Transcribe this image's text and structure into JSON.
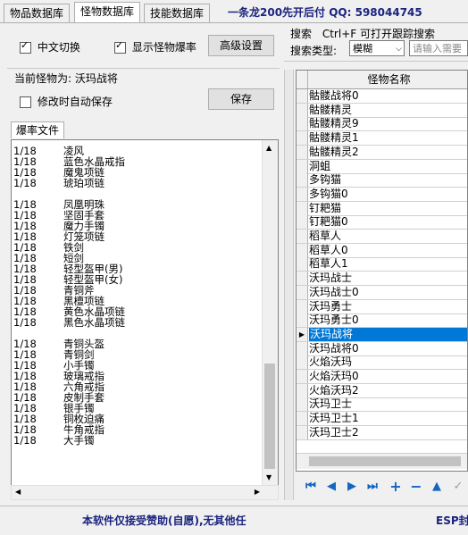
{
  "tabs": [
    "物品数据库",
    "怪物数据库",
    "技能数据库"
  ],
  "promo_text": "一条龙200先开后付 QQ: 598044745",
  "toolbar": {
    "chinese_switch": "中文切换",
    "show_drops": "显示怪物爆率",
    "advanced_settings": "高级设置",
    "search_label": "搜索",
    "search_hint": "Ctrl+F 可打开跟踪搜索",
    "search_type_label": "搜索类型:",
    "search_type_value": "模糊",
    "search_placeholder": "请输入需要"
  },
  "current_monster": {
    "label": "当前怪物为: 沃玛战将",
    "auto_save": "修改时自动保存",
    "save_button": "保存"
  },
  "drop_file": {
    "title": "爆率文件",
    "lines": [
      [
        "1/18",
        "凌风"
      ],
      [
        "1/18",
        "蓝色水晶戒指"
      ],
      [
        "1/18",
        "魔鬼项链"
      ],
      [
        "1/18",
        "琥珀项链"
      ],
      [
        "",
        ""
      ],
      [
        "1/18",
        "凤凰明珠"
      ],
      [
        "1/18",
        "坚固手套"
      ],
      [
        "1/18",
        "魔力手镯"
      ],
      [
        "1/18",
        "灯笼项链"
      ],
      [
        "1/18",
        "铁剑"
      ],
      [
        "1/18",
        "短剑"
      ],
      [
        "1/18",
        "轻型盔甲(男)"
      ],
      [
        "1/18",
        "轻型盔甲(女)"
      ],
      [
        "1/18",
        "青铜斧"
      ],
      [
        "1/18",
        "黑檀项链"
      ],
      [
        "1/18",
        "黄色水晶项链"
      ],
      [
        "1/18",
        "黑色水晶项链"
      ],
      [
        "",
        ""
      ],
      [
        "1/18",
        "青铜头盔"
      ],
      [
        "1/18",
        "青铜剑"
      ],
      [
        "1/18",
        "小手镯"
      ],
      [
        "1/18",
        "玻璃戒指"
      ],
      [
        "1/18",
        "六角戒指"
      ],
      [
        "1/18",
        "皮制手套"
      ],
      [
        "1/18",
        "银手镯"
      ],
      [
        "1/18",
        "铜枚迫痛"
      ],
      [
        "1/18",
        "牛角戒指"
      ],
      [
        "1/18",
        "大手镯"
      ]
    ]
  },
  "monster_grid": {
    "header": "怪物名称",
    "rows": [
      "骷髅战将0",
      "骷髅精灵",
      "骷髅精灵9",
      "骷髅精灵1",
      "骷髅精灵2",
      "洞蛆",
      "多钩猫",
      "多钩猫0",
      "钉耙猫",
      "钉耙猫0",
      "稻草人",
      "稻草人0",
      "稻草人1",
      "沃玛战士",
      "沃玛战士0",
      "沃玛勇士",
      "沃玛勇士0",
      "沃玛战将",
      "沃玛战将0",
      "火焰沃玛",
      "火焰沃玛0",
      "火焰沃玛2",
      "沃玛卫士",
      "沃玛卫士1",
      "沃玛卫士2"
    ],
    "selected_index": 17
  },
  "nav_icons": [
    "first-icon",
    "prev-icon",
    "next-icon",
    "last-icon",
    "add-icon",
    "delete-icon",
    "up-icon",
    "confirm-icon"
  ],
  "status_bar": {
    "notice": "本软件仅接受赞助(自愿),无其他任",
    "right_text": "ESP封"
  },
  "colors": {
    "selection": "#0078d7",
    "promo": "#1a237e",
    "nav": "#1565c0"
  }
}
